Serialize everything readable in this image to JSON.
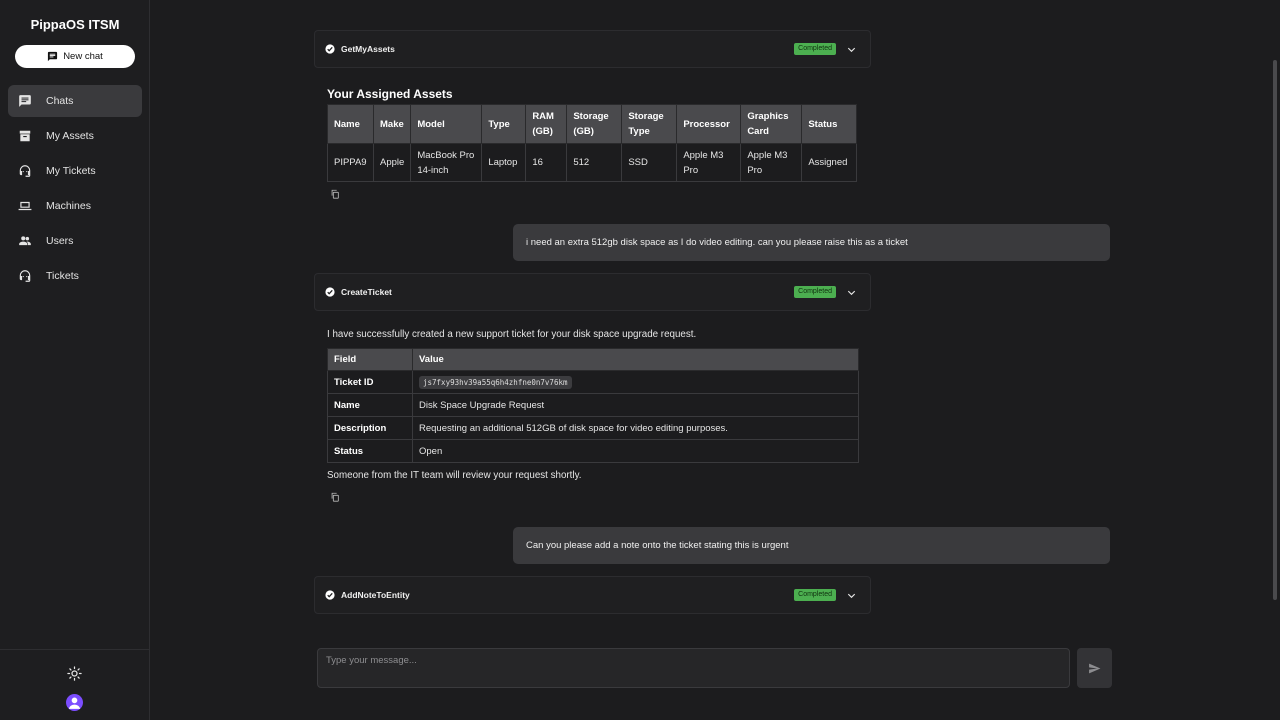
{
  "app": {
    "title": "PippaOS ITSM"
  },
  "sidebar": {
    "new_chat_label": "New chat",
    "items": [
      {
        "label": "Chats",
        "icon": "chat-icon",
        "active": true
      },
      {
        "label": "My Assets",
        "icon": "archive-icon"
      },
      {
        "label": "My Tickets",
        "icon": "support-agent-icon"
      },
      {
        "label": "Machines",
        "icon": "laptop-icon"
      },
      {
        "label": "Users",
        "icon": "people-icon"
      },
      {
        "label": "Tickets",
        "icon": "support-agent-icon"
      }
    ],
    "theme_icon": "sun-icon",
    "avatar_icon": "user-avatar-icon"
  },
  "chat": {
    "tool_calls": [
      {
        "name": "GetMyAssets",
        "status": "Completed"
      },
      {
        "name": "CreateTicket",
        "status": "Completed"
      },
      {
        "name": "AddNoteToEntity",
        "status": "Completed"
      }
    ],
    "assets": {
      "title": "Your Assigned Assets",
      "headers": [
        "Name",
        "Make",
        "Model",
        "Type",
        "RAM (GB)",
        "Storage (GB)",
        "Storage Type",
        "Processor",
        "Graphics Card",
        "Status"
      ],
      "rows": [
        [
          "PIPPA9",
          "Apple",
          "MacBook Pro 14-inch",
          "Laptop",
          "16",
          "512",
          "SSD",
          "Apple M3 Pro",
          "Apple M3 Pro",
          "Assigned"
        ]
      ]
    },
    "user_messages": [
      "i need an extra 512gb disk space as I do video editing. can you please raise this as a ticket",
      "Can you please add a note onto the ticket stating this is urgent"
    ],
    "ticket_intro": "I have successfully created a new support ticket for your disk space upgrade request.",
    "ticket": {
      "headers": [
        "Field",
        "Value"
      ],
      "rows": [
        {
          "field": "Ticket ID",
          "value": "js7fxy93hv39a55q6h4zhfne0n7v76km"
        },
        {
          "field": "Name",
          "value": "Disk Space Upgrade Request"
        },
        {
          "field": "Description",
          "value": "Requesting an additional 512GB of disk space for video editing purposes."
        },
        {
          "field": "Status",
          "value": "Open"
        }
      ]
    },
    "ticket_outro": "Someone from the IT team will review your request shortly."
  },
  "composer": {
    "placeholder": "Type your message..."
  },
  "colors": {
    "completed_badge": "#4caf50",
    "avatar": "#7c4dff",
    "user_bubble": "#3a3a3d"
  }
}
